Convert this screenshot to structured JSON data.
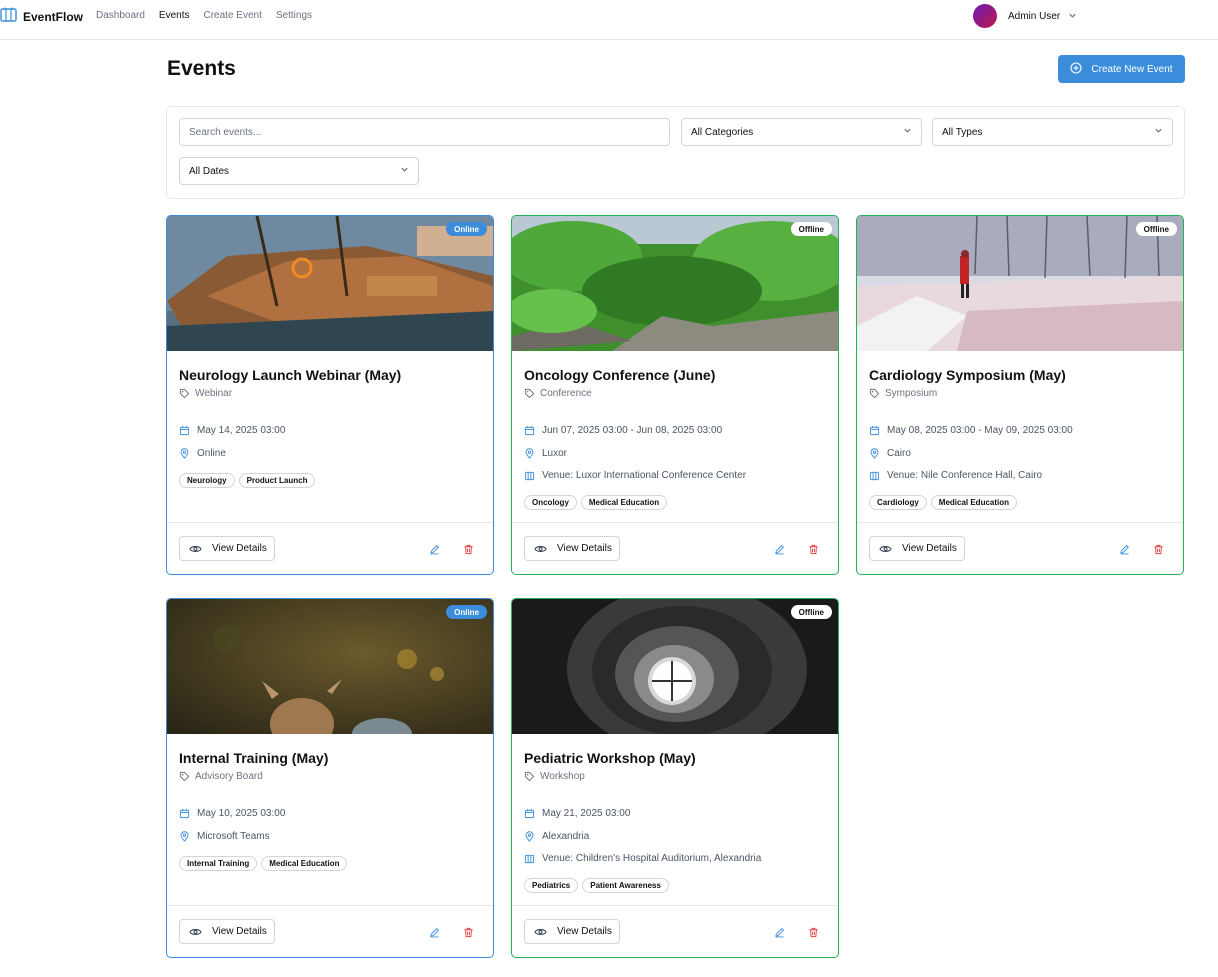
{
  "app": {
    "brand": "EventFlow",
    "nav": [
      "Dashboard",
      "Events",
      "Create Event",
      "Settings"
    ],
    "active_nav": "Events",
    "user_name": "Admin User"
  },
  "page": {
    "title": "Events",
    "create_button": "Create New Event"
  },
  "filters": {
    "search_placeholder": "Search events...",
    "category": "All Categories",
    "type": "All Types",
    "dates": "All Dates"
  },
  "colors": {
    "accent": "#3b8ddb",
    "online_border": "#3b8ddb",
    "offline_border": "#22b157",
    "edit_icon": "#3b8ddb",
    "delete_icon": "#e53e3e"
  },
  "cards": [
    {
      "title": "Neurology Launch Webinar (May)",
      "category": "Webinar",
      "mode": "Online",
      "date": "May 14, 2025 03:00",
      "location": "Online",
      "venue": "",
      "tags": [
        "Neurology",
        "Product Launch"
      ],
      "view_label": "View Details",
      "image": "harbor-boat"
    },
    {
      "title": "Oncology Conference (June)",
      "category": "Conference",
      "mode": "Offline",
      "date": "Jun 07, 2025 03:00 - Jun 08, 2025 03:00",
      "location": "Luxor",
      "venue": "Venue: Luxor International Conference Center",
      "tags": [
        "Oncology",
        "Medical Education"
      ],
      "view_label": "View Details",
      "image": "green-forest"
    },
    {
      "title": "Cardiology Symposium (May)",
      "category": "Symposium",
      "mode": "Offline",
      "date": "May 08, 2025 03:00 - May 09, 2025 03:00",
      "location": "Cairo",
      "venue": "Venue: Nile Conference Hall, Cairo",
      "tags": [
        "Cardiology",
        "Medical Education"
      ],
      "view_label": "View Details",
      "image": "snowy-field"
    },
    {
      "title": "Internal Training (May)",
      "category": "Advisory Board",
      "mode": "Online",
      "date": "May 10, 2025 03:00",
      "location": "Microsoft Teams",
      "venue": "",
      "tags": [
        "Internal Training",
        "Medical Education"
      ],
      "view_label": "View Details",
      "image": "deer"
    },
    {
      "title": "Pediatric Workshop (May)",
      "category": "Workshop",
      "mode": "Offline",
      "date": "May 21, 2025 03:00",
      "location": "Alexandria",
      "venue": "Venue: Children's Hospital Auditorium, Alexandria",
      "tags": [
        "Pediatrics",
        "Patient Awareness"
      ],
      "view_label": "View Details",
      "image": "spiral-staircase"
    }
  ]
}
